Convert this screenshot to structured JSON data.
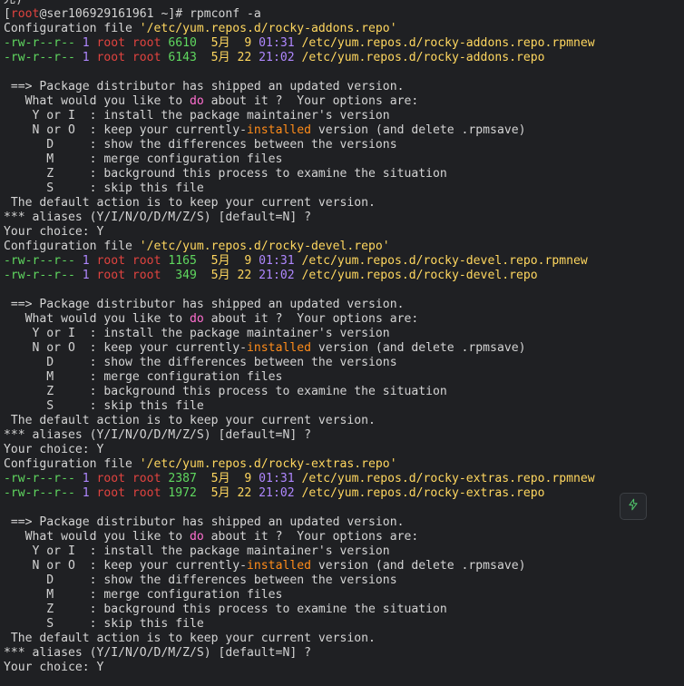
{
  "colors": {
    "default": "#d4d4d4",
    "white": "#e6e6e6",
    "green": "#5fd75f",
    "yellow": "#ffd75f",
    "red": "#e0433f",
    "purple": "#af87ff",
    "pink": "#ff6fd0",
    "orange": "#ff8c1a",
    "accent": "#4fc16a"
  },
  "terminal": {
    "lines": [
      {
        "segs": [
          {
            "t": "光)",
            "c": "default"
          }
        ]
      },
      {
        "segs": [
          {
            "t": "[",
            "c": "default"
          },
          {
            "t": "root",
            "c": "red"
          },
          {
            "t": "@ser106929161961 ~]# rpmconf -a",
            "c": "default"
          }
        ]
      },
      {
        "segs": [
          {
            "t": "Configuration file ",
            "c": "default"
          },
          {
            "t": "'/etc/yum.repos.d/rocky-addons.repo'",
            "c": "yellow"
          }
        ]
      },
      {
        "segs": [
          {
            "t": "-rw-r--r-- ",
            "c": "green"
          },
          {
            "t": "1 ",
            "c": "purple"
          },
          {
            "t": "root root ",
            "c": "red"
          },
          {
            "t": "6610 ",
            "c": "green"
          },
          {
            "t": " 5月  9 ",
            "c": "yellow"
          },
          {
            "t": "01:31 ",
            "c": "purple"
          },
          {
            "t": "/etc/yum.repos.d/rocky-addons.repo.rpmnew",
            "c": "yellow"
          }
        ]
      },
      {
        "segs": [
          {
            "t": "-rw-r--r-- ",
            "c": "green"
          },
          {
            "t": "1 ",
            "c": "purple"
          },
          {
            "t": "root root ",
            "c": "red"
          },
          {
            "t": "6143 ",
            "c": "green"
          },
          {
            "t": " 5月 22 ",
            "c": "yellow"
          },
          {
            "t": "21:02 ",
            "c": "purple"
          },
          {
            "t": "/etc/yum.repos.d/rocky-addons.repo",
            "c": "yellow"
          }
        ]
      },
      {
        "segs": []
      },
      {
        "segs": [
          {
            "t": " ==> Package distributor has shipped an updated version.",
            "c": "default"
          }
        ]
      },
      {
        "segs": [
          {
            "t": "   What would you like to ",
            "c": "default"
          },
          {
            "t": "do",
            "c": "pink"
          },
          {
            "t": " about it ?  Your options are:",
            "c": "default"
          }
        ]
      },
      {
        "segs": [
          {
            "t": "    Y or I  : install the package maintainer's version",
            "c": "default"
          }
        ]
      },
      {
        "segs": [
          {
            "t": "    N or O  : keep your currently-",
            "c": "default"
          },
          {
            "t": "installed",
            "c": "orange"
          },
          {
            "t": " version (and delete .rpmsave)",
            "c": "default"
          }
        ]
      },
      {
        "segs": [
          {
            "t": "      D     : show the differences between the versions",
            "c": "default"
          }
        ]
      },
      {
        "segs": [
          {
            "t": "      M     : merge configuration files",
            "c": "default"
          }
        ]
      },
      {
        "segs": [
          {
            "t": "      Z     : background this process to examine the situation",
            "c": "default"
          }
        ]
      },
      {
        "segs": [
          {
            "t": "      S     : skip this file",
            "c": "default"
          }
        ]
      },
      {
        "segs": [
          {
            "t": " The default action is to keep your current version.",
            "c": "default"
          }
        ]
      },
      {
        "segs": [
          {
            "t": "*** aliases (Y/I/N/O/D/M/Z/S) [default=N] ?",
            "c": "default"
          }
        ]
      },
      {
        "segs": [
          {
            "t": "Your choice: Y",
            "c": "default"
          }
        ]
      },
      {
        "segs": [
          {
            "t": "Configuration file ",
            "c": "default"
          },
          {
            "t": "'/etc/yum.repos.d/rocky-devel.repo'",
            "c": "yellow"
          }
        ]
      },
      {
        "segs": [
          {
            "t": "-rw-r--r-- ",
            "c": "green"
          },
          {
            "t": "1 ",
            "c": "purple"
          },
          {
            "t": "root root ",
            "c": "red"
          },
          {
            "t": "1165 ",
            "c": "green"
          },
          {
            "t": " 5月  9 ",
            "c": "yellow"
          },
          {
            "t": "01:31 ",
            "c": "purple"
          },
          {
            "t": "/etc/yum.repos.d/rocky-devel.repo.rpmnew",
            "c": "yellow"
          }
        ]
      },
      {
        "segs": [
          {
            "t": "-rw-r--r-- ",
            "c": "green"
          },
          {
            "t": "1 ",
            "c": "purple"
          },
          {
            "t": "root root ",
            "c": "red"
          },
          {
            "t": " 349 ",
            "c": "green"
          },
          {
            "t": " 5月 22 ",
            "c": "yellow"
          },
          {
            "t": "21:02 ",
            "c": "purple"
          },
          {
            "t": "/etc/yum.repos.d/rocky-devel.repo",
            "c": "yellow"
          }
        ]
      },
      {
        "segs": []
      },
      {
        "segs": [
          {
            "t": " ==> Package distributor has shipped an updated version.",
            "c": "default"
          }
        ]
      },
      {
        "segs": [
          {
            "t": "   What would you like to ",
            "c": "default"
          },
          {
            "t": "do",
            "c": "pink"
          },
          {
            "t": " about it ?  Your options are:",
            "c": "default"
          }
        ]
      },
      {
        "segs": [
          {
            "t": "    Y or I  : install the package maintainer's version",
            "c": "default"
          }
        ]
      },
      {
        "segs": [
          {
            "t": "    N or O  : keep your currently-",
            "c": "default"
          },
          {
            "t": "installed",
            "c": "orange"
          },
          {
            "t": " version (and delete .rpmsave)",
            "c": "default"
          }
        ]
      },
      {
        "segs": [
          {
            "t": "      D     : show the differences between the versions",
            "c": "default"
          }
        ]
      },
      {
        "segs": [
          {
            "t": "      M     : merge configuration files",
            "c": "default"
          }
        ]
      },
      {
        "segs": [
          {
            "t": "      Z     : background this process to examine the situation",
            "c": "default"
          }
        ]
      },
      {
        "segs": [
          {
            "t": "      S     : skip this file",
            "c": "default"
          }
        ]
      },
      {
        "segs": [
          {
            "t": " The default action is to keep your current version.",
            "c": "default"
          }
        ]
      },
      {
        "segs": [
          {
            "t": "*** aliases (Y/I/N/O/D/M/Z/S) [default=N] ?",
            "c": "default"
          }
        ]
      },
      {
        "segs": [
          {
            "t": "Your choice: Y",
            "c": "default"
          }
        ]
      },
      {
        "segs": [
          {
            "t": "Configuration file ",
            "c": "default"
          },
          {
            "t": "'/etc/yum.repos.d/rocky-extras.repo'",
            "c": "yellow"
          }
        ]
      },
      {
        "segs": [
          {
            "t": "-rw-r--r-- ",
            "c": "green"
          },
          {
            "t": "1 ",
            "c": "purple"
          },
          {
            "t": "root root ",
            "c": "red"
          },
          {
            "t": "2387 ",
            "c": "green"
          },
          {
            "t": " 5月  9 ",
            "c": "yellow"
          },
          {
            "t": "01:31 ",
            "c": "purple"
          },
          {
            "t": "/etc/yum.repos.d/rocky-extras.repo.rpmnew",
            "c": "yellow"
          }
        ]
      },
      {
        "segs": [
          {
            "t": "-rw-r--r-- ",
            "c": "green"
          },
          {
            "t": "1 ",
            "c": "purple"
          },
          {
            "t": "root root ",
            "c": "red"
          },
          {
            "t": "1972 ",
            "c": "green"
          },
          {
            "t": " 5月 22 ",
            "c": "yellow"
          },
          {
            "t": "21:02 ",
            "c": "purple"
          },
          {
            "t": "/etc/yum.repos.d/rocky-extras.repo",
            "c": "yellow"
          }
        ]
      },
      {
        "segs": []
      },
      {
        "segs": [
          {
            "t": " ==> Package distributor has shipped an updated version.",
            "c": "default"
          }
        ]
      },
      {
        "segs": [
          {
            "t": "   What would you like to ",
            "c": "default"
          },
          {
            "t": "do",
            "c": "pink"
          },
          {
            "t": " about it ?  Your options are:",
            "c": "default"
          }
        ]
      },
      {
        "segs": [
          {
            "t": "    Y or I  : install the package maintainer's version",
            "c": "default"
          }
        ]
      },
      {
        "segs": [
          {
            "t": "    N or O  : keep your currently-",
            "c": "default"
          },
          {
            "t": "installed",
            "c": "orange"
          },
          {
            "t": " version (and delete .rpmsave)",
            "c": "default"
          }
        ]
      },
      {
        "segs": [
          {
            "t": "      D     : show the differences between the versions",
            "c": "default"
          }
        ]
      },
      {
        "segs": [
          {
            "t": "      M     : merge configuration files",
            "c": "default"
          }
        ]
      },
      {
        "segs": [
          {
            "t": "      Z     : background this process to examine the situation",
            "c": "default"
          }
        ]
      },
      {
        "segs": [
          {
            "t": "      S     : skip this file",
            "c": "default"
          }
        ]
      },
      {
        "segs": [
          {
            "t": " The default action is to keep your current version.",
            "c": "default"
          }
        ]
      },
      {
        "segs": [
          {
            "t": "*** aliases (Y/I/N/O/D/M/Z/S) [default=N] ?",
            "c": "default"
          }
        ]
      },
      {
        "segs": [
          {
            "t": "Your choice: Y",
            "c": "default"
          }
        ]
      }
    ]
  },
  "floating_button": {
    "icon": "lightning-icon"
  }
}
